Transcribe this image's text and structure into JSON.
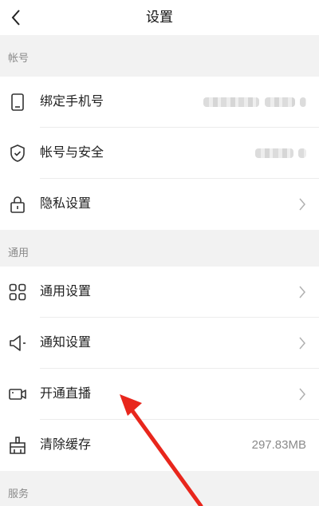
{
  "header": {
    "title": "设置",
    "back_icon": "chevron-left-icon"
  },
  "sections": {
    "account": {
      "title": "帐号"
    },
    "general": {
      "title": "通用"
    },
    "service": {
      "title": "服务"
    }
  },
  "rows": {
    "bind_phone": {
      "label": "绑定手机号",
      "icon": "phone-icon",
      "value_obscured": true
    },
    "account_security": {
      "label": "帐号与安全",
      "icon": "shield-check-icon",
      "value_obscured": true
    },
    "privacy": {
      "label": "隐私设置",
      "icon": "lock-icon"
    },
    "general_settings": {
      "label": "通用设置",
      "icon": "grid-icon"
    },
    "notification": {
      "label": "通知设置",
      "icon": "speaker-icon"
    },
    "live": {
      "label": "开通直播",
      "icon": "video-camera-icon"
    },
    "clear_cache": {
      "label": "清除缓存",
      "icon": "broom-icon",
      "value": "297.83MB"
    }
  },
  "annotation": {
    "arrow_color": "#e8261c",
    "points_to": "开通直播"
  }
}
